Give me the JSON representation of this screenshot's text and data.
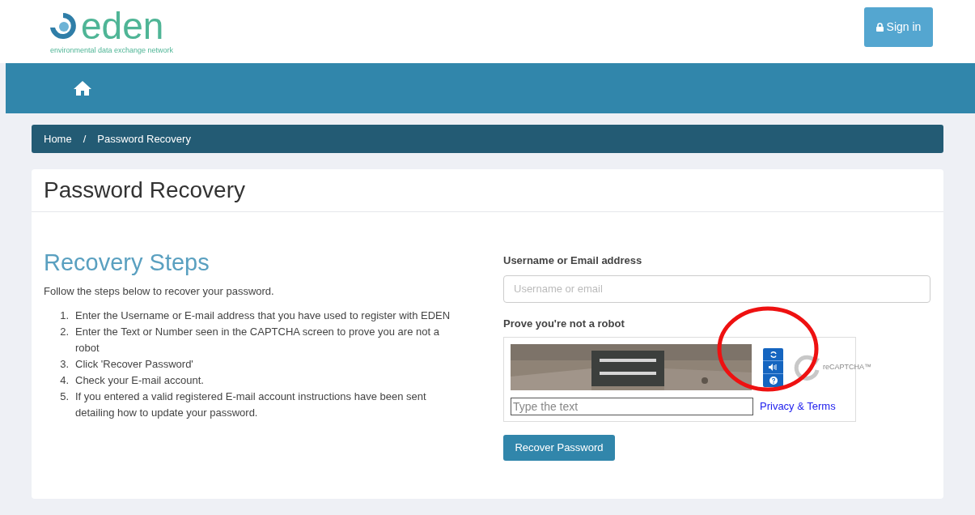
{
  "logo": {
    "name": "eden",
    "tagline": "environmental data exchange network"
  },
  "sign_in": {
    "label": "Sign in"
  },
  "breadcrumb": [
    {
      "label": "Home"
    },
    {
      "label": "Password Recovery"
    }
  ],
  "breadcrumb_separator": "/",
  "page_title": "Password Recovery",
  "steps": {
    "heading": "Recovery Steps",
    "intro": "Follow the steps below to recover your password.",
    "items": [
      {
        "number": "1.",
        "text": "Enter the Username or E-mail address that you have used to register with EDEN"
      },
      {
        "number": "2.",
        "text": "Enter the Text or Number seen in the CAPTCHA screen to prove you are not a robot"
      },
      {
        "number": "3.",
        "text": "Click 'Recover Password'"
      },
      {
        "number": "4.",
        "text": "Check your E-mail account."
      },
      {
        "number": "5.",
        "text": "If you entered a valid registered E-mail account instructions have been sent detailing how to update your password."
      }
    ]
  },
  "form": {
    "username_label": "Username or Email address",
    "username_placeholder": "Username or email",
    "captcha_label": "Prove you're not a robot",
    "captcha": {
      "placeholder": "Type the text",
      "brand": "reCAPTCHA™",
      "link": "Privacy & Terms"
    },
    "submit": "Recover Password"
  },
  "annotation": {
    "kind": "ellipse",
    "color": "#ee1111"
  }
}
